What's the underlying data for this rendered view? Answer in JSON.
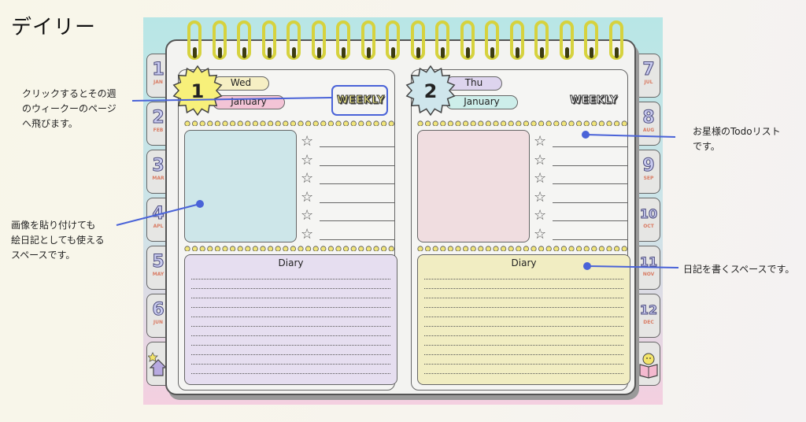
{
  "page_title": "デイリー",
  "notes": {
    "weekly_link": "クリックするとその週\nのウィークーのページ\nへ飛びます。",
    "image_area": "画像を貼り付けても\n絵日記としても使える\nスペースです。",
    "todo_list": "お星様のTodoリスト\nです。",
    "diary_area": "日記を書くスペースです。"
  },
  "left_tabs": [
    {
      "num": "1",
      "month": "JAN"
    },
    {
      "num": "2",
      "month": "FEB"
    },
    {
      "num": "3",
      "month": "MAR"
    },
    {
      "num": "4",
      "month": "APL"
    },
    {
      "num": "5",
      "month": "MAY"
    },
    {
      "num": "6",
      "month": "JUN"
    }
  ],
  "right_tabs": [
    {
      "num": "7",
      "month": "JUL"
    },
    {
      "num": "8",
      "month": "AUG"
    },
    {
      "num": "9",
      "month": "SEP"
    },
    {
      "num": "10",
      "month": "OCT"
    },
    {
      "num": "11",
      "month": "NOV"
    },
    {
      "num": "12",
      "month": "DEC"
    }
  ],
  "icons": {
    "home": "home-icon",
    "book": "book-icon",
    "star": "star-icon"
  },
  "pages": [
    {
      "day_num": "1",
      "weekday": "Wed",
      "month": "January",
      "weekly": "WEEKLY",
      "diary_label": "Diary",
      "badge_color": "#f7f07a",
      "weekday_color": "#f6efc4",
      "month_color": "#f3c4d6",
      "photo_color": "#cde6e9",
      "diary_color": "#e6def0"
    },
    {
      "day_num": "2",
      "weekday": "Thu",
      "month": "January",
      "weekly": "WEEKLY",
      "diary_label": "Diary",
      "badge_color": "#cfe6ec",
      "weekday_color": "#ddd4ee",
      "month_color": "#cdeeea",
      "photo_color": "#f0dde0",
      "diary_color": "#f1edc2"
    }
  ]
}
